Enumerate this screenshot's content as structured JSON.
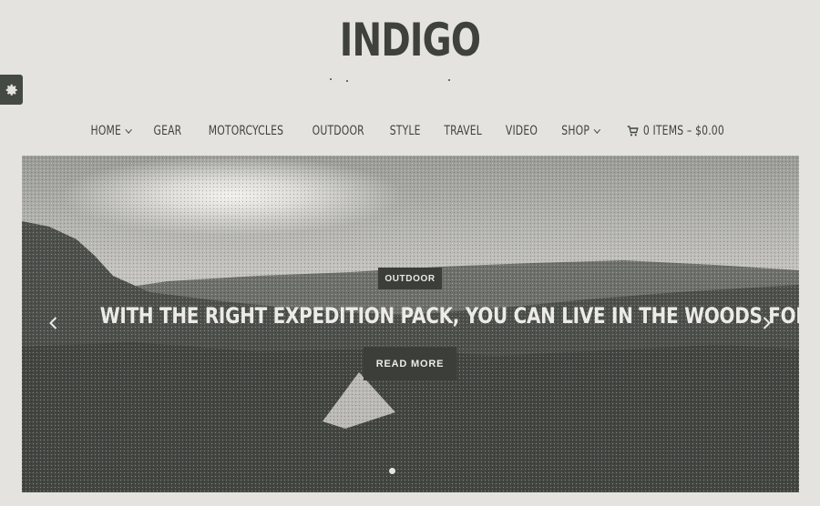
{
  "site": {
    "title": "INDIGO"
  },
  "settings_tab": {
    "icon": "gear-icon"
  },
  "nav": {
    "items": [
      {
        "label": "HOME",
        "has_dropdown": true
      },
      {
        "label": "GEAR",
        "has_dropdown": false
      },
      {
        "label": "MOTORCYCLES",
        "has_dropdown": false
      },
      {
        "label": "OUTDOOR",
        "has_dropdown": false
      },
      {
        "label": "STYLE",
        "has_dropdown": false
      },
      {
        "label": "TRAVEL",
        "has_dropdown": false
      },
      {
        "label": "VIDEO",
        "has_dropdown": false
      },
      {
        "label": "SHOP",
        "has_dropdown": true
      }
    ],
    "cart": {
      "icon": "cart-icon",
      "label": "0 ITEMS – $0.00"
    }
  },
  "slider": {
    "category": "OUTDOOR",
    "title": "WITH THE RIGHT EXPEDITION PACK, YOU CAN LIVE IN THE WOODS FOREVER",
    "button": "READ MORE",
    "prev_icon": "chevron-left-icon",
    "next_icon": "chevron-right-icon",
    "slide_count": 1,
    "active_slide": 1
  },
  "colors": {
    "background": "#e4e3e0",
    "text": "#3f423d",
    "dark_button": "#3b3e39",
    "hero_dark": "#474a45"
  }
}
